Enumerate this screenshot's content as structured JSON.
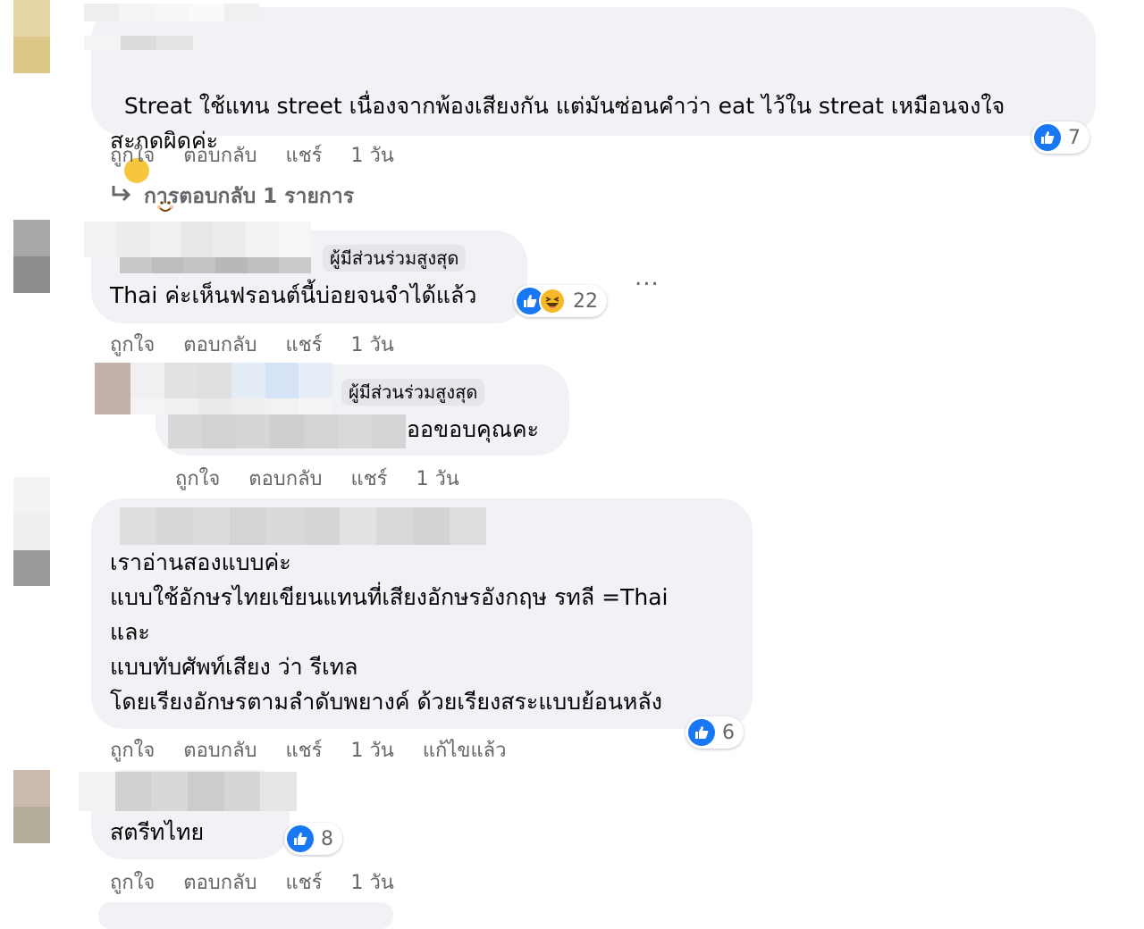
{
  "reactions": {
    "like_icon": "thumbs-up-icon",
    "haha_icon": "haha-emoji-icon",
    "like_color": "#1877f2"
  },
  "comments": [
    {
      "text": "Streat ใช้แทน street เนื่องจากพ้องเสียงกัน แต่มันซ่อนคำว่า eat ไว้ใน streat เหมือนจงใจ\nสะกดผิดค่ะ",
      "emoji": "smiling-face-icon",
      "reaction_count": "7",
      "actions": {
        "like": "ถูกใจ",
        "reply": "ตอบกลับ",
        "share": "แชร์",
        "time": "1 วัน"
      },
      "replies_link": "การตอบกลับ 1 รายการ"
    },
    {
      "badge": "ผู้มีส่วนร่วมสูงสุด",
      "text": "Thai ค่ะเห็นฟรอนต์นี้บ่อยจนจำได้แล้ว",
      "reaction_count": "22",
      "more_label": "...",
      "actions": {
        "like": "ถูกใจ",
        "reply": "ตอบกลับ",
        "share": "แชร์",
        "time": "1 วัน"
      }
    },
    {
      "badge": "ผู้มีส่วนร่วมสูงสุด",
      "text": "ออขอบคุณคะ",
      "actions": {
        "like": "ถูกใจ",
        "reply": "ตอบกลับ",
        "share": "แชร์",
        "time": "1 วัน"
      }
    },
    {
      "text": "เราอ่านสองแบบค่ะ\nแบบใช้อักษรไทยเขียนแทนที่เสียงอักษรอังกฤษ รทลี =Thai\nและ\nแบบทับศัพท์เสียง ว่า รีเทล\nโดยเรียงอักษรตามลำดับพยางค์ ด้วยเรียงสระแบบย้อนหลัง",
      "reaction_count": "6",
      "actions": {
        "like": "ถูกใจ",
        "reply": "ตอบกลับ",
        "share": "แชร์",
        "time": "1 วัน",
        "edited": "แก้ไขแล้ว"
      }
    },
    {
      "text": "สตรีทไทย",
      "reaction_count": "8",
      "actions": {
        "like": "ถูกใจ",
        "reply": "ตอบกลับ",
        "share": "แชร์",
        "time": "1 วัน"
      }
    }
  ]
}
